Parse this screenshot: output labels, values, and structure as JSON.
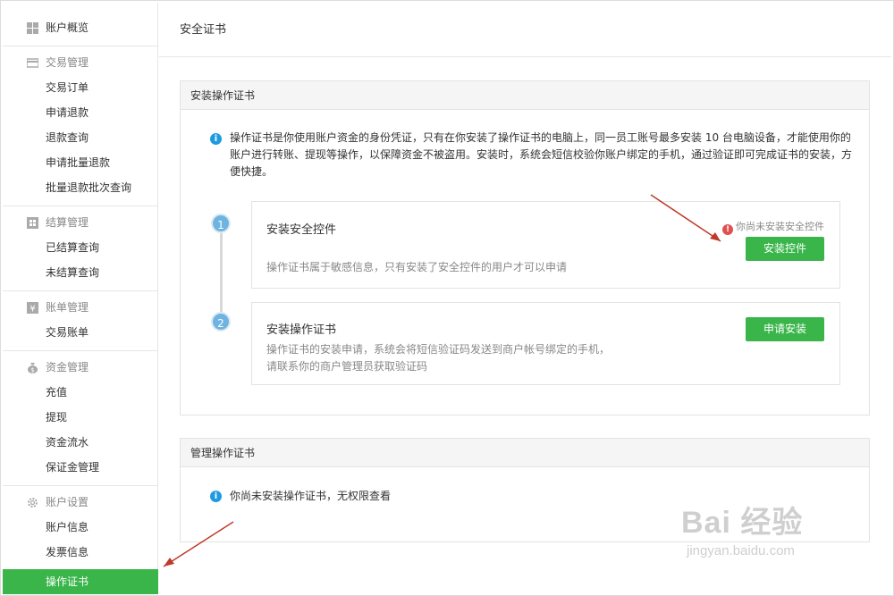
{
  "sidebar": {
    "overview": "账户概览",
    "groups": [
      {
        "title": "交易管理",
        "icon": "transaction-icon",
        "items": [
          "交易订单",
          "申请退款",
          "退款查询",
          "申请批量退款",
          "批量退款批次查询"
        ]
      },
      {
        "title": "结算管理",
        "icon": "settlement-icon",
        "items": [
          "已结算查询",
          "未结算查询"
        ]
      },
      {
        "title": "账单管理",
        "icon": "bill-icon",
        "items": [
          "交易账单"
        ]
      },
      {
        "title": "资金管理",
        "icon": "money-bag-icon",
        "items": [
          "充值",
          "提现",
          "资金流水",
          "保证金管理"
        ]
      },
      {
        "title": "账户设置",
        "icon": "gear-icon",
        "items": [
          "账户信息",
          "发票信息",
          "操作证书"
        ]
      }
    ],
    "active_item": "操作证书"
  },
  "main": {
    "title": "安全证书",
    "install_panel": {
      "heading": "安装操作证书",
      "notice": "操作证书是你使用账户资金的身份凭证，只有在你安装了操作证书的电脑上，同一员工账号最多安装 10 台电脑设备，才能使用你的账户进行转账、提现等操作，以保障资金不被盗用。安装时，系统会短信校验你账户绑定的手机，通过验证即可完成证书的安装，方便快捷。",
      "steps": [
        {
          "number": "1",
          "title": "安装安全控件",
          "desc": "操作证书属于敏感信息，只有安装了安全控件的用户才可以申请",
          "warning": "你尚未安装安全控件",
          "button": "安装控件"
        },
        {
          "number": "2",
          "title": "安装操作证书",
          "desc_line1": "操作证书的安装申请，系统会将短信验证码发送到商户帐号绑定的手机，",
          "desc_line2": "请联系你的商户管理员获取验证码",
          "button": "申请安装"
        }
      ]
    },
    "manage_panel": {
      "heading": "管理操作证书",
      "notice": "你尚未安装操作证书，无权限查看"
    }
  },
  "watermark": {
    "main": "Bai 经验",
    "sub": "jingyan.baidu.com"
  },
  "colors": {
    "accent_green": "#39b54a",
    "info_blue": "#1e9be0",
    "step_blue": "#6fb4e0",
    "warn_red": "#e05050",
    "arrow_red": "#c0392b"
  }
}
